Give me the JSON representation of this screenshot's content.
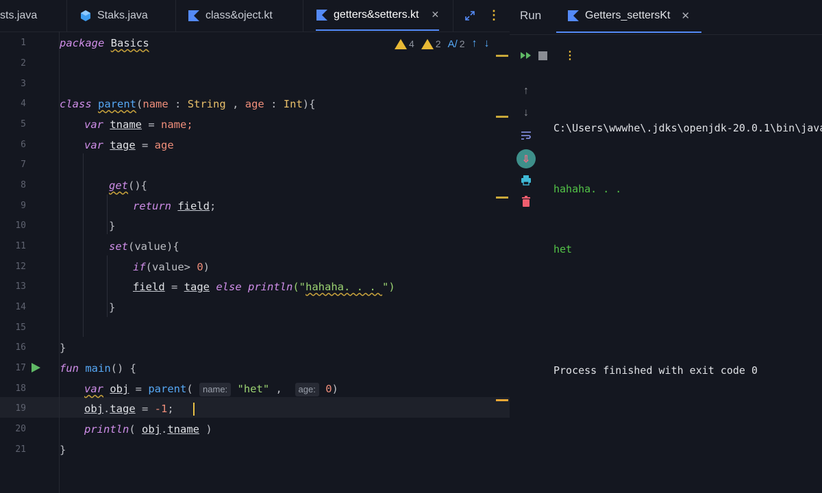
{
  "editor": {
    "tabs": [
      {
        "name": "sts.java",
        "icon": "java-file-icon",
        "active": false
      },
      {
        "name": "Staks.java",
        "icon": "java-class-icon",
        "active": false
      },
      {
        "name": "class&oject.kt",
        "icon": "kotlin-file-icon",
        "active": false
      },
      {
        "name": "getters&setters.kt",
        "icon": "kotlin-file-icon",
        "active": true
      }
    ],
    "tab_close": "✕",
    "inspections": {
      "warnings_a": "4",
      "warnings_b": "2",
      "typos": "2"
    },
    "line_numbers": [
      "1",
      "2",
      "3",
      "4",
      "5",
      "6",
      "7",
      "8",
      "9",
      "10",
      "11",
      "12",
      "13",
      "14",
      "15",
      "16",
      "17",
      "18",
      "19",
      "20",
      "21"
    ],
    "code": {
      "l1": {
        "kw": "package",
        "name": "Basics"
      },
      "l4": {
        "kw": "class",
        "cls": "parent",
        "p1": "name",
        "t1": "String",
        "p2": "age",
        "t2": "Int",
        "open": "{",
        "colon": ":",
        "comma": ","
      },
      "l5": {
        "kw": "var",
        "prop": "tname",
        "val": "name;"
      },
      "l6": {
        "kw": "var",
        "prop": "tage",
        "val": "age"
      },
      "l8": {
        "fn": "get",
        "tail": "(){"
      },
      "l9": {
        "kw": "return",
        "field": "field",
        "tail": ";"
      },
      "l10": {
        "text": "}"
      },
      "l11": {
        "fn": "set",
        "tail": "(value){"
      },
      "l12": {
        "kw": "if",
        "tail": "(value> ",
        "num": "0",
        "close": ")"
      },
      "l13": {
        "field": "field",
        "eq": " = ",
        "prop": "tage",
        "kw": "else",
        "fn": "println",
        "str_open": "(\"",
        "str": "hahaha. . . ",
        "str_close": "\")"
      },
      "l14": {
        "text": "}"
      },
      "l16": {
        "text": "}"
      },
      "l17": {
        "kw": "fun",
        "fn": "main",
        "tail": "() {"
      },
      "l18": {
        "kw": "var",
        "obj": "obj",
        "eq": " = ",
        "fn": "parent",
        "paren": "(",
        "hint1": "name:",
        "str": "\"het\"",
        "comma": " ,",
        "hint2": "age:",
        "num": "0",
        "close": ")"
      },
      "l19": {
        "obj": "obj",
        "dot": ".",
        "prop": "tage",
        "eq": " = ",
        "num": "-1",
        "tail": ";"
      },
      "l20": {
        "fn": "println",
        "open": "( ",
        "obj": "obj",
        "dot": ".",
        "prop": "tname",
        "close": " )"
      },
      "l21": {
        "text": "}"
      }
    }
  },
  "run_panel": {
    "label": "Run",
    "tab": "Getters_settersKt",
    "tab_close": "✕",
    "console": {
      "command": "C:\\Users\\wwwhe\\.jdks\\openjdk-20.0.1\\bin\\java",
      "output": [
        "hahaha. . .",
        "het"
      ],
      "exit": "Process finished with exit code 0"
    }
  },
  "colors": {
    "accent": "#548af7",
    "output_green": "#53c347",
    "keyword": "#cf8ee8",
    "string": "#9ad171",
    "type": "#e8bf6a",
    "warning": "#e8b935"
  }
}
